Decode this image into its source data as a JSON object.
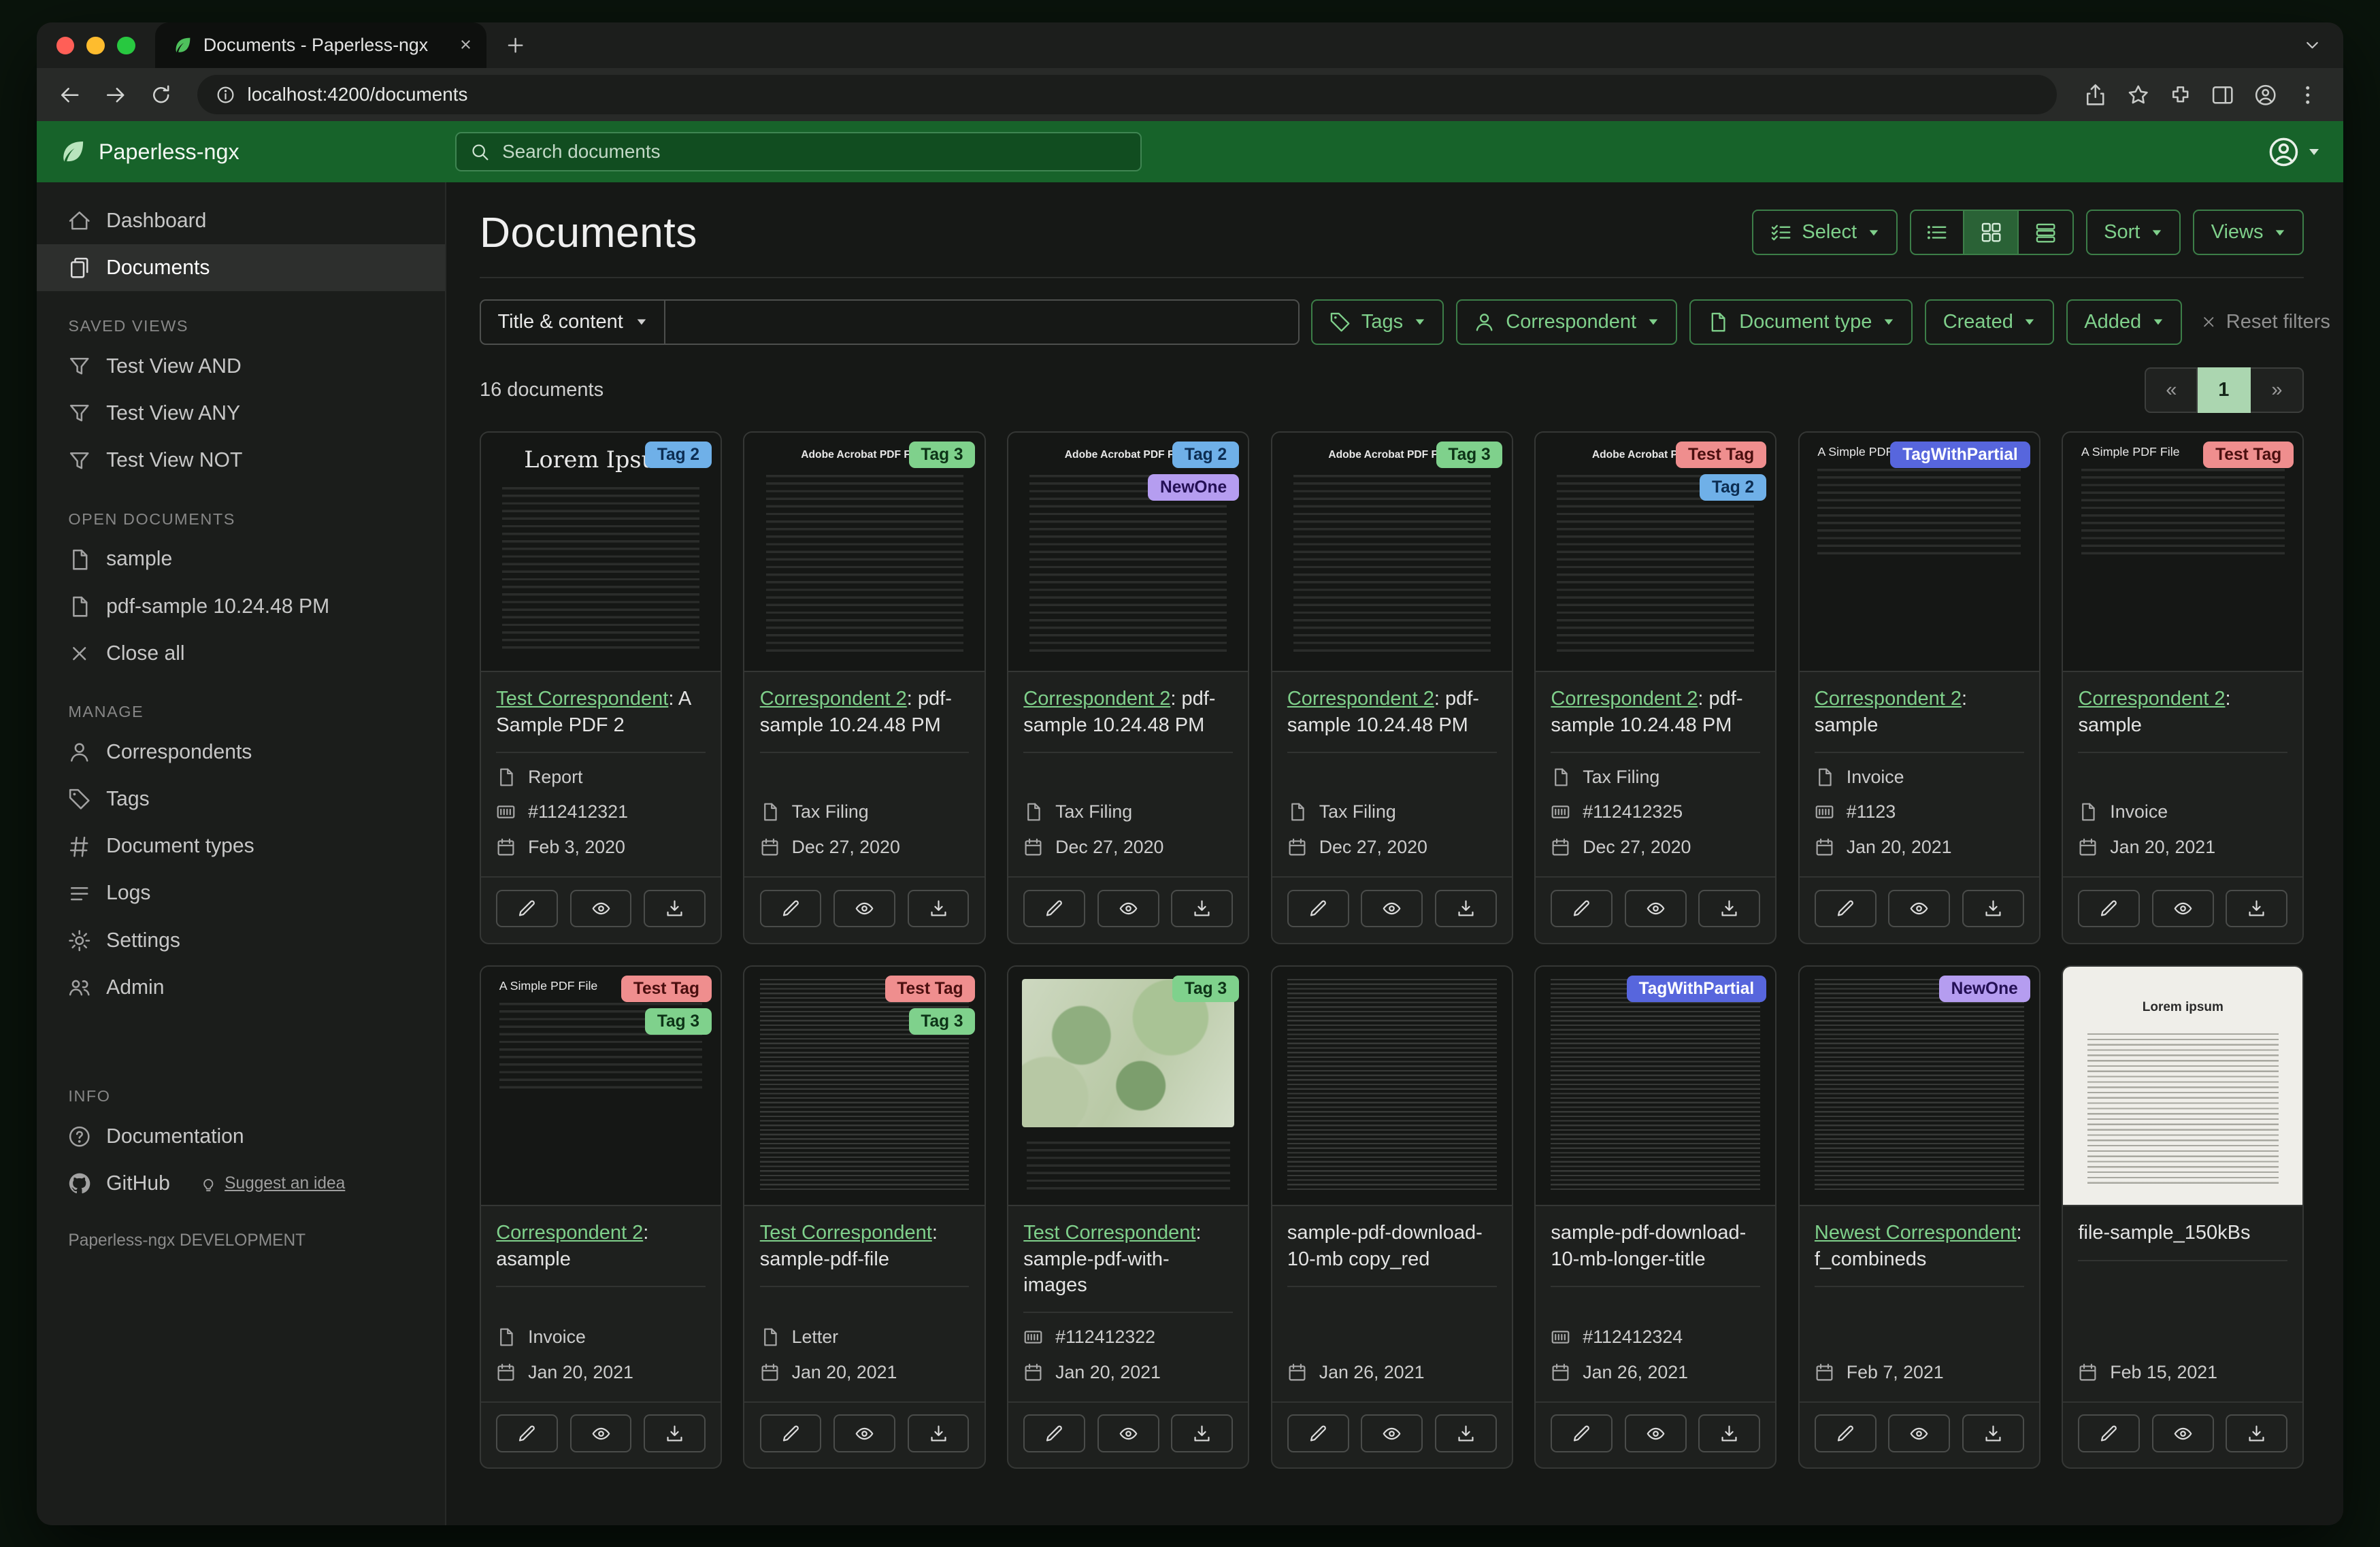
{
  "browser": {
    "tab_title": "Documents - Paperless-ngx",
    "url": "localhost:4200/documents"
  },
  "appbar": {
    "brand": "Paperless-ngx",
    "search_placeholder": "Search documents"
  },
  "sidebar": {
    "sections": [
      {
        "title": null,
        "items": [
          {
            "label": "Dashboard",
            "icon": "house",
            "active": false
          },
          {
            "label": "Documents",
            "icon": "files",
            "active": true
          }
        ]
      },
      {
        "title": "SAVED VIEWS",
        "items": [
          {
            "label": "Test View AND",
            "icon": "funnel"
          },
          {
            "label": "Test View ANY",
            "icon": "funnel"
          },
          {
            "label": "Test View NOT",
            "icon": "funnel"
          }
        ]
      },
      {
        "title": "OPEN DOCUMENTS",
        "items": [
          {
            "label": "sample",
            "icon": "file"
          },
          {
            "label": "pdf-sample 10.24.48 PM",
            "icon": "file"
          },
          {
            "label": "Close all",
            "icon": "x"
          }
        ]
      },
      {
        "title": "MANAGE",
        "items": [
          {
            "label": "Correspondents",
            "icon": "person"
          },
          {
            "label": "Tags",
            "icon": "tag"
          },
          {
            "label": "Document types",
            "icon": "hash"
          },
          {
            "label": "Logs",
            "icon": "list"
          },
          {
            "label": "Settings",
            "icon": "gear"
          },
          {
            "label": "Admin",
            "icon": "people"
          }
        ]
      },
      {
        "title": "INFO",
        "items": [
          {
            "label": "Documentation",
            "icon": "question"
          },
          {
            "label": "GitHub",
            "icon": "github",
            "extra": "Suggest an idea",
            "extra_icon": "bulb"
          }
        ]
      }
    ],
    "footer": "Paperless-ngx DEVELOPMENT"
  },
  "main": {
    "title": "Documents",
    "select_label": "Select",
    "sort_label": "Sort",
    "views_label": "Views",
    "filters": {
      "field_label": "Title & content",
      "buttons": [
        {
          "label": "Tags",
          "icon": "tag"
        },
        {
          "label": "Correspondent",
          "icon": "person"
        },
        {
          "label": "Document type",
          "icon": "file"
        },
        {
          "label": "Created",
          "icon": null
        },
        {
          "label": "Added",
          "icon": null
        }
      ],
      "reset_label": "Reset filters"
    },
    "count": "16 documents",
    "pagination": {
      "prev": "«",
      "current": "1",
      "next": "»"
    }
  },
  "colors": {
    "accent_green": "#7fd08b",
    "header_green": "#17632a"
  },
  "tag_colors": {
    "Tag 2": {
      "bg": "#6fb0e8",
      "fg": "#0c2d52"
    },
    "Tag 3": {
      "bg": "#7fd18c",
      "fg": "#0d3317"
    },
    "NewOne": {
      "bg": "#b59df0",
      "fg": "#241055"
    },
    "Test Tag": {
      "bg": "#ef8e8e",
      "fg": "#4a0f0f"
    },
    "TagWithPartial": {
      "bg": "#5766dd",
      "fg": "#ffffff"
    }
  },
  "documents": [
    {
      "correspondent": "Test Correspondent",
      "title": ": A Sample PDF 2",
      "tags": [
        "Tag 2"
      ],
      "doc_type": "Report",
      "asn": "#112412321",
      "date": "Feb 3, 2020",
      "thumb": "lorem",
      "thumb_title": "Lorem Ipsum"
    },
    {
      "correspondent": "Correspondent 2",
      "title": ": pdf-sample 10.24.48 PM",
      "tags": [
        "Tag 3"
      ],
      "doc_type": "Tax Filing",
      "asn": null,
      "date": "Dec 27, 2020",
      "thumb": "adobe",
      "thumb_title": "Adobe Acrobat PDF Files"
    },
    {
      "correspondent": "Correspondent 2",
      "title": ": pdf-sample 10.24.48 PM",
      "tags": [
        "Tag 2",
        "NewOne"
      ],
      "doc_type": "Tax Filing",
      "asn": null,
      "date": "Dec 27, 2020",
      "thumb": "adobe",
      "thumb_title": "Adobe Acrobat PDF Files"
    },
    {
      "correspondent": "Correspondent 2",
      "title": ": pdf-sample 10.24.48 PM",
      "tags": [
        "Tag 3"
      ],
      "doc_type": "Tax Filing",
      "asn": null,
      "date": "Dec 27, 2020",
      "thumb": "adobe",
      "thumb_title": "Adobe Acrobat PDF Files"
    },
    {
      "correspondent": "Correspondent 2",
      "title": ": pdf-sample 10.24.48 PM",
      "tags": [
        "Test Tag",
        "Tag 2"
      ],
      "doc_type": "Tax Filing",
      "asn": "#112412325",
      "date": "Dec 27, 2020",
      "thumb": "adobe",
      "thumb_title": "Adobe Acrobat PDF Files"
    },
    {
      "correspondent": "Correspondent 2",
      "title": ": sample",
      "tags": [
        "TagWithPartial"
      ],
      "doc_type": "Invoice",
      "asn": "#1123",
      "date": "Jan 20, 2021",
      "thumb": "simple",
      "thumb_title": "A Simple PDF File"
    },
    {
      "correspondent": "Correspondent 2",
      "title": ": sample",
      "tags": [
        "Test Tag"
      ],
      "doc_type": "Invoice",
      "asn": null,
      "date": "Jan 20, 2021",
      "thumb": "simple",
      "thumb_title": "A Simple PDF File"
    },
    {
      "correspondent": "Correspondent 2",
      "title": ": asample",
      "tags": [
        "Test Tag",
        "Tag 3"
      ],
      "doc_type": "Invoice",
      "asn": null,
      "date": "Jan 20, 2021",
      "thumb": "simple",
      "thumb_title": "A Simple PDF File"
    },
    {
      "correspondent": "Test Correspondent",
      "title": ": sample-pdf-file",
      "tags": [
        "Test Tag",
        "Tag 3"
      ],
      "doc_type": "Letter",
      "asn": null,
      "date": "Jan 20, 2021",
      "thumb": "dense",
      "thumb_title": ""
    },
    {
      "correspondent": "Test Correspondent",
      "title": ": sample-pdf-with-images",
      "tags": [
        "Tag 3"
      ],
      "doc_type": null,
      "asn": "#112412322",
      "date": "Jan 20, 2021",
      "thumb": "map",
      "thumb_title": ""
    },
    {
      "correspondent": null,
      "title": "sample-pdf-download-10-mb copy_red",
      "tags": [],
      "doc_type": null,
      "asn": null,
      "date": "Jan 26, 2021",
      "thumb": "dense",
      "thumb_title": ""
    },
    {
      "correspondent": null,
      "title": "sample-pdf-download-10-mb-longer-title",
      "tags": [
        "TagWithPartial"
      ],
      "doc_type": null,
      "asn": "#112412324",
      "date": "Jan 26, 2021",
      "thumb": "dense",
      "thumb_title": ""
    },
    {
      "correspondent": "Newest Correspondent",
      "title": ": f_combineds",
      "tags": [
        "NewOne"
      ],
      "doc_type": null,
      "asn": null,
      "date": "Feb 7, 2021",
      "thumb": "dense",
      "thumb_title": ""
    },
    {
      "correspondent": null,
      "title": "file-sample_150kBs",
      "tags": [],
      "doc_type": null,
      "asn": null,
      "date": "Feb 15, 2021",
      "thumb": "light",
      "thumb_title": "Lorem ipsum"
    }
  ]
}
